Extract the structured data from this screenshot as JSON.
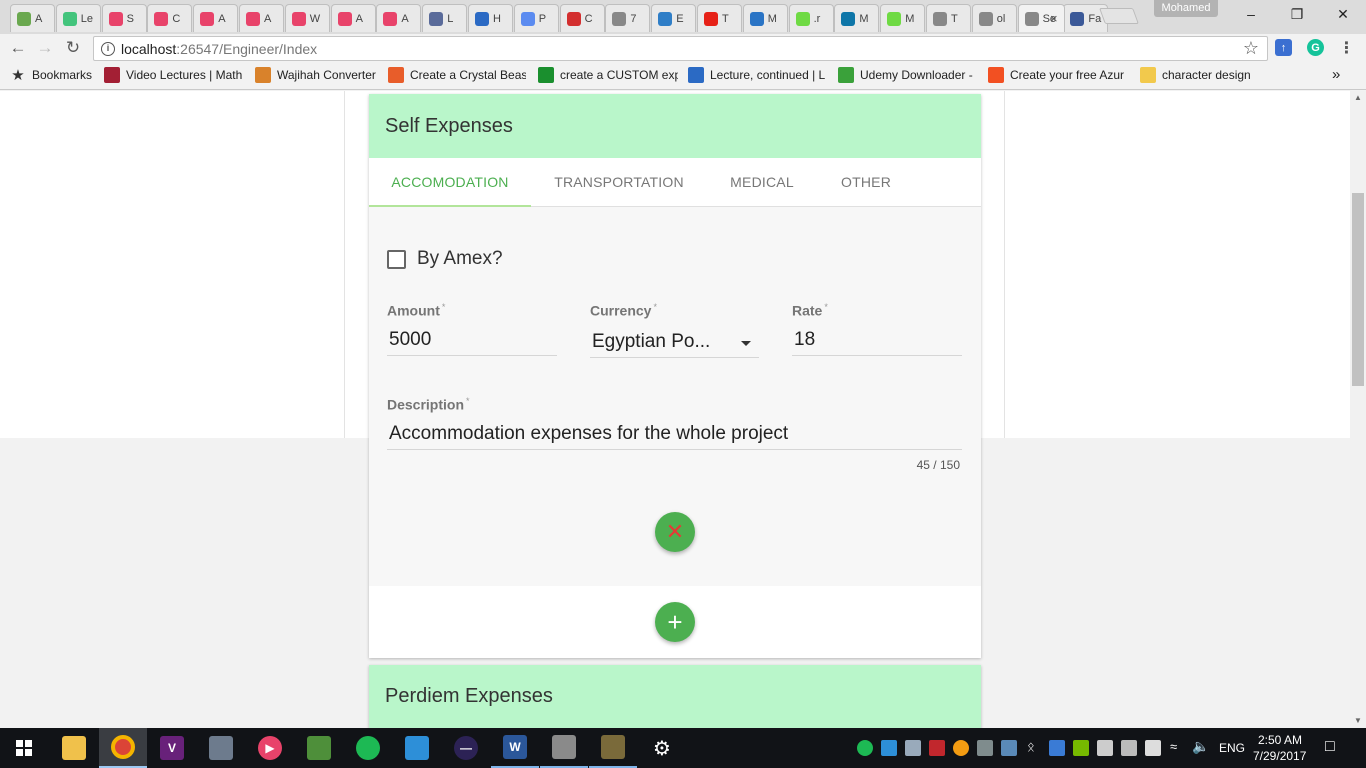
{
  "browser": {
    "tabs": [
      {
        "label": "A",
        "color": "#6aa84f"
      },
      {
        "label": "Le",
        "color": "#43c47c"
      },
      {
        "label": "S",
        "color": "#e8436a"
      },
      {
        "label": "C",
        "color": "#e8436a"
      },
      {
        "label": "A",
        "color": "#e8436a"
      },
      {
        "label": "A",
        "color": "#e8436a"
      },
      {
        "label": "W",
        "color": "#e8436a"
      },
      {
        "label": "A",
        "color": "#e8436a"
      },
      {
        "label": "A",
        "color": "#e8436a"
      },
      {
        "label": "L",
        "color": "#5a6b9a"
      },
      {
        "label": "H",
        "color": "#2b6ac4"
      },
      {
        "label": "P",
        "color": "#5b8bf0"
      },
      {
        "label": "C",
        "color": "#d32f2f"
      },
      {
        "label": "7",
        "color": "#888888"
      },
      {
        "label": "E",
        "color": "#2f7ec7"
      },
      {
        "label": "T",
        "color": "#e62117"
      },
      {
        "label": "M",
        "color": "#2a74c5"
      },
      {
        "label": ".r",
        "color": "#6fda44"
      },
      {
        "label": "M",
        "color": "#0e76a8"
      },
      {
        "label": "M",
        "color": "#6fda44"
      },
      {
        "label": "T",
        "color": "#888888"
      },
      {
        "label": "ol",
        "color": "#888888"
      },
      {
        "label": "Se",
        "color": "#888888"
      },
      {
        "label": "Fa",
        "color": "#3b5998"
      }
    ],
    "profile_name": "Mohamed",
    "url_host": "localhost",
    "url_path": ":26547/Engineer/Index",
    "bookmarks": [
      {
        "label": "Bookmarks",
        "color": "#555555"
      },
      {
        "label": "Video Lectures | Math",
        "color": "#a31f34"
      },
      {
        "label": "Wajihah Converter",
        "color": "#d9822b"
      },
      {
        "label": "Create a Crystal Beast",
        "color": "#e85d2a"
      },
      {
        "label": "create a CUSTOM exp",
        "color": "#1a8f2e"
      },
      {
        "label": "Lecture, continued | L",
        "color": "#2b6ac4"
      },
      {
        "label": "Udemy Downloader -",
        "color": "#3aa13a"
      },
      {
        "label": "Create your free Azur",
        "color": "#f25022"
      },
      {
        "label": "character design",
        "color": "#f2c94c"
      }
    ],
    "bookmarks_more": "»"
  },
  "page": {
    "self_expenses": {
      "title": "Self Expenses",
      "tabs": [
        "ACCOMODATION",
        "TRANSPORTATION",
        "MEDICAL",
        "OTHER"
      ],
      "active_tab": "ACCOMODATION",
      "amex_label": "By Amex?",
      "amex_checked": false,
      "amount_label": "Amount",
      "amount_value": "5000",
      "currency_label": "Currency",
      "currency_value": "Egyptian Po...",
      "rate_label": "Rate",
      "rate_value": "18",
      "description_label": "Description",
      "description_value": "Accommodation expenses for the whole project",
      "description_counter": "45 / 150",
      "required_mark": "*",
      "delete_icon": "close-icon",
      "add_icon": "plus-icon"
    },
    "perdiem_expenses": {
      "title": "Perdiem Expenses"
    },
    "accent_color": "#4caf50",
    "header_color": "#b9f6ca"
  },
  "taskbar": {
    "language": "ENG",
    "time": "2:50 AM",
    "date": "7/29/2017"
  }
}
